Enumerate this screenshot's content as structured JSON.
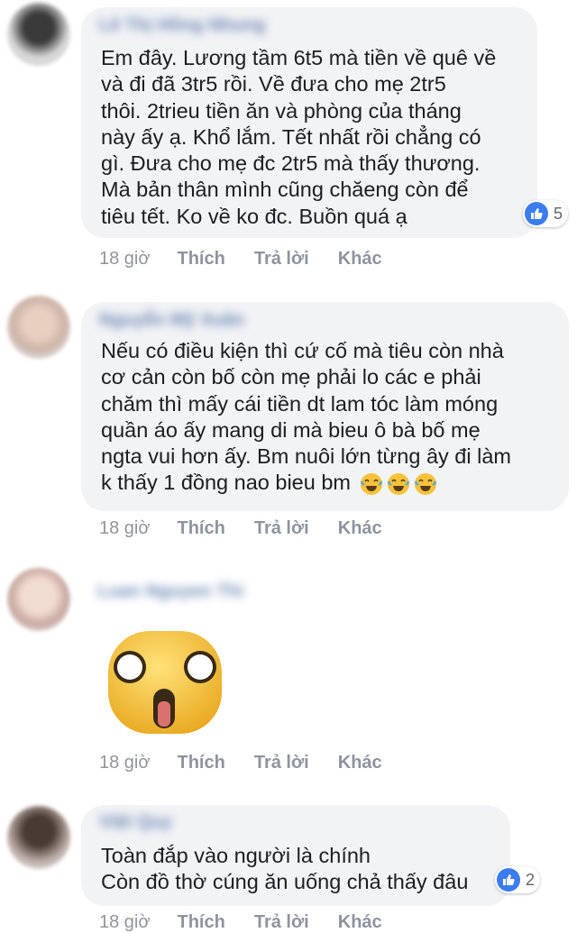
{
  "comments": [
    {
      "author": "Lê Thị Hồng Nhung",
      "lines": [
        "Em đây. Lương tầm 6t5 mà tiền về quê về",
        "và đi đã 3tr5 rồi. Về đưa cho mẹ 2tr5",
        "thôi. 2trieu tiền ăn và phòng của tháng",
        "này ấy ạ. Khổ lắm. Tết nhất rồi chẳng có",
        "gì. Đưa cho mẹ đc 2tr5 mà thấy thương.",
        "Mà bản thân mình cũng chăeng còn để",
        "tiêu tết. Ko về ko đc. Buồn quá ạ"
      ],
      "reaction_count": "5",
      "time": "18 giờ",
      "like": "Thích",
      "reply": "Trả lời",
      "more": "Khác"
    },
    {
      "author": "Nguyễn Mỹ Xuân",
      "lines": [
        "Nếu có điều kiện thì cứ cố mà tiêu còn nhà",
        "cơ cản còn bố còn mẹ phải lo các e phải",
        "chăm thì mấy cái tiền dt lam tóc làm móng",
        "quần áo ấy mang di mà bieu ô bà bố mẹ",
        "ngta vui hơn ấy. Bm nuôi lớn từng ây đi làm",
        "k thấy 1 đồng nao bieu bm"
      ],
      "emoji": "tears-of-joy",
      "time": "18 giờ",
      "like": "Thích",
      "reply": "Trả lời",
      "more": "Khác"
    },
    {
      "author": "Luan Nguyen Thi",
      "sticker": "shocked-face-sticker",
      "time": "18 giờ",
      "like": "Thích",
      "reply": "Trả lời",
      "more": "Khác"
    },
    {
      "author": "Việt Quy",
      "lines": [
        "Toàn đắp vào người là chính",
        "Còn đồ thờ cúng ăn uống chả thấy đâu"
      ],
      "reaction_count": "2",
      "time": "18 giờ",
      "like": "Thích",
      "reply": "Trả lời",
      "more": "Khác"
    }
  ],
  "colors": {
    "bubble": "#f2f3f5",
    "like_blue": "#3b7cf0",
    "action_gray": "#8d949e"
  }
}
